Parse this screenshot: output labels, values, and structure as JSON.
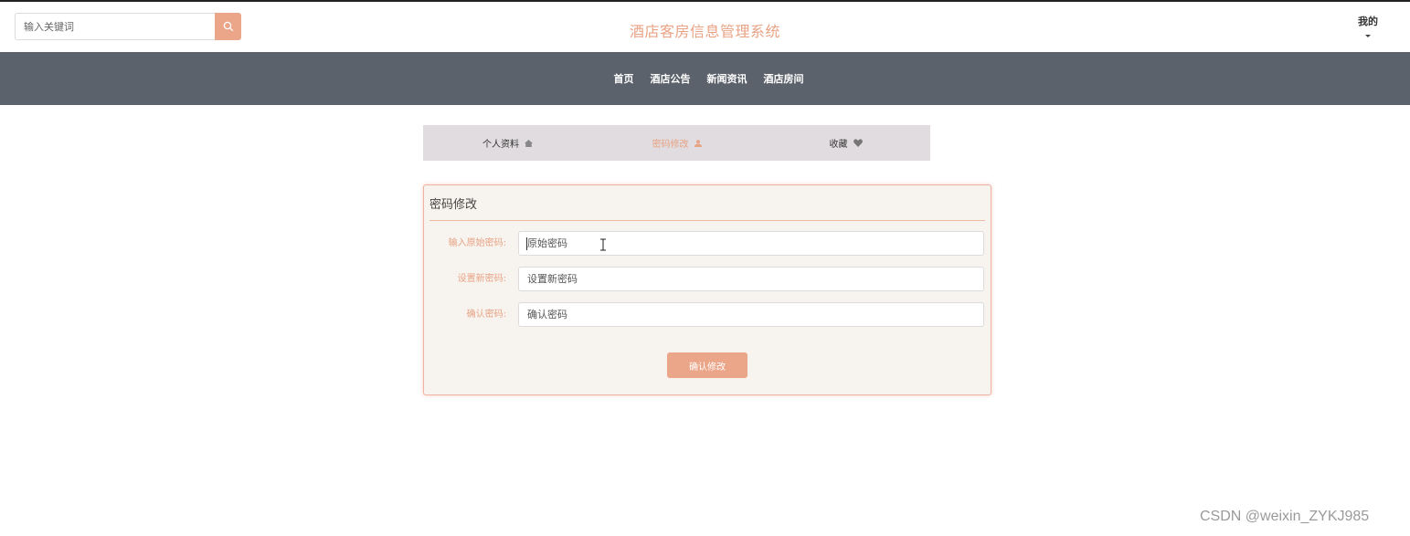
{
  "header": {
    "search": {
      "placeholder": "输入关键词",
      "icon": "search-icon"
    },
    "title": "酒店客房信息管理系统",
    "user_menu": {
      "label": "我的",
      "icon": "caret-down-icon"
    }
  },
  "nav": {
    "items": [
      {
        "label": "首页"
      },
      {
        "label": "酒店公告"
      },
      {
        "label": "新闻资讯"
      },
      {
        "label": "酒店房间"
      }
    ]
  },
  "tabs": {
    "items": [
      {
        "label": "个人资料",
        "icon": "home-icon"
      },
      {
        "label": "密码修改",
        "icon": "user-icon",
        "active": true
      },
      {
        "label": "收藏",
        "icon": "heart-icon"
      }
    ]
  },
  "form": {
    "title": "密码修改",
    "fields": [
      {
        "label": "输入原始密码:",
        "placeholder": "原始密码"
      },
      {
        "label": "设置新密码:",
        "placeholder": "设置新密码"
      },
      {
        "label": "确认密码:",
        "placeholder": "确认密码"
      }
    ],
    "submit_label": "确认修改"
  },
  "watermark": "CSDN @weixin_ZYKJ985",
  "colors": {
    "accent": "#eba689",
    "nav_bg": "#5c626b",
    "tabs_bg": "#e0dcdf",
    "panel_bg": "#f7f3ee"
  }
}
